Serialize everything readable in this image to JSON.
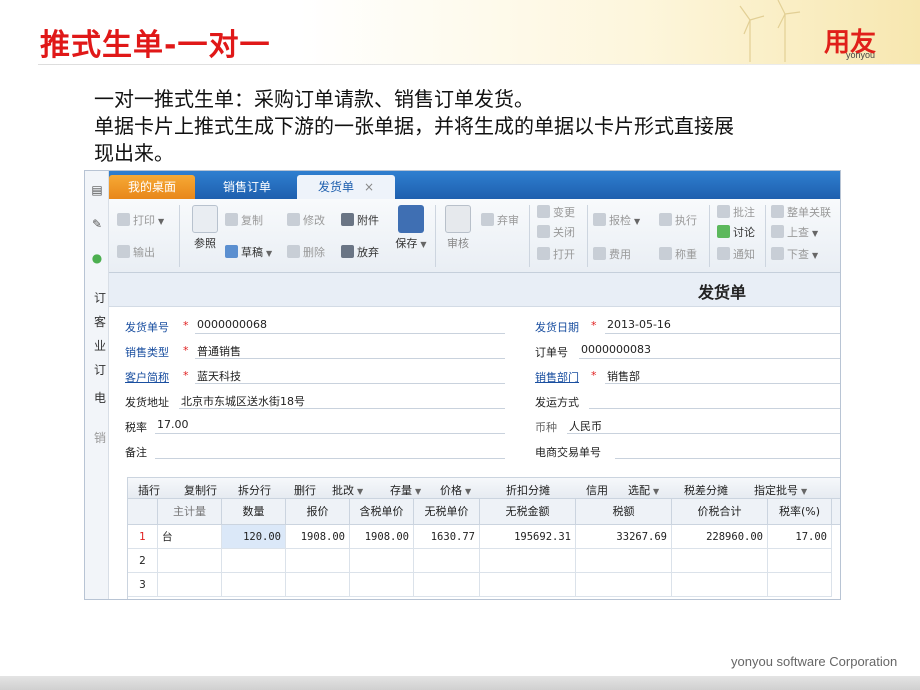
{
  "slide": {
    "title": "推式生单-一对一",
    "logo_main": "用友",
    "logo_sub": "yonyou",
    "body_lines": [
      "一对一推式生单：采购订单请款、销售订单发货。",
      "单据卡片上推式生成下游的一张单据，并将生成的单据以卡片形式直接展",
      "现出来。"
    ],
    "footer": "yonyou software Corporation"
  },
  "app": {
    "tabs": [
      {
        "label": "我的桌面"
      },
      {
        "label": "销售订单"
      },
      {
        "label": "发货单",
        "close": "×"
      }
    ],
    "left_rail_text": [
      "订",
      "客",
      "业",
      "订",
      "电",
      "销"
    ],
    "toolbar": {
      "print": "打印",
      "export": "输出",
      "copy": "复制",
      "modify": "修改",
      "attach": "附件",
      "refer": "参照",
      "draft": "草稿",
      "delete": "删除",
      "discard": "放弃",
      "save": "保存",
      "review": "审核",
      "abandon_review": "弃审",
      "change": "变更",
      "close": "关闭",
      "open": "打开",
      "inspect": "报检",
      "execute": "执行",
      "cost": "费用",
      "weigh": "称重",
      "annotate": "批注",
      "discuss": "讨论",
      "notify": "通知",
      "whole_link": "整单关联",
      "prev": "上查",
      "next": "下查"
    },
    "form": {
      "title": "发货单",
      "fields": {
        "delivery_no_label": "发货单号",
        "delivery_no": "0000000068",
        "sales_type_label": "销售类型",
        "sales_type": "普通销售",
        "customer_label": "客户简称",
        "customer": "蓝天科技",
        "address_label": "发货地址",
        "address": "北京市东城区送水街18号",
        "tax_rate_label": "税率",
        "tax_rate": "17.00",
        "remark_label": "备注",
        "delivery_date_label": "发货日期",
        "delivery_date": "2013-05-16",
        "order_no_label": "订单号",
        "order_no": "0000000083",
        "sales_dept_label": "销售部门",
        "sales_dept": "销售部",
        "ship_method_label": "发运方式",
        "currency_label": "币种",
        "currency": "人民币",
        "ecommerce_label": "电商交易单号"
      },
      "required_mark": "*"
    },
    "grid_toolbar": [
      "插行",
      "复制行",
      "拆分行",
      "删行",
      "批改",
      "存量",
      "价格",
      "折扣分摊",
      "信用",
      "选配",
      "税差分摊",
      "指定批号"
    ],
    "grid": {
      "headers": [
        "主计量",
        "数量",
        "报价",
        "含税单价",
        "无税单价",
        "无税金额",
        "税额",
        "价税合计",
        "税率(%)"
      ],
      "rows": [
        {
          "no": "1",
          "unit": "台",
          "qty": "120.00",
          "quote": "1908.00",
          "tax_price": "1908.00",
          "notax_price": "1630.77",
          "notax_amount": "195692.31",
          "tax": "33267.69",
          "total": "228960.00",
          "rate": "17.00"
        },
        {
          "no": "2"
        },
        {
          "no": "3"
        }
      ]
    }
  }
}
